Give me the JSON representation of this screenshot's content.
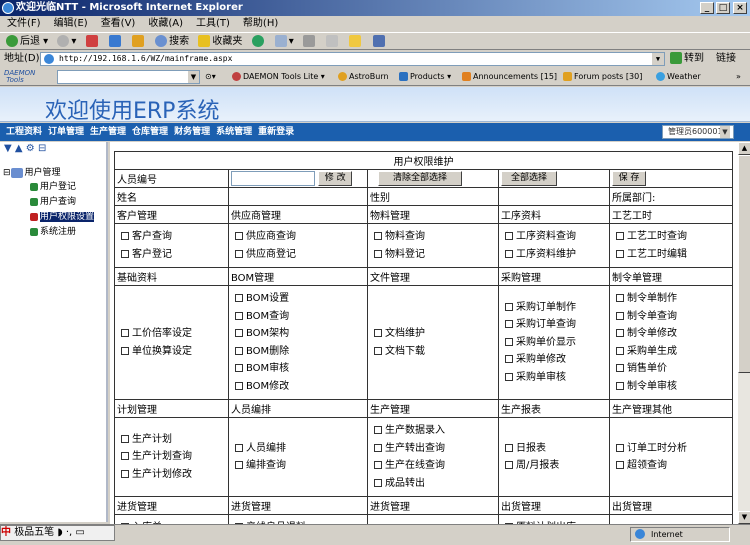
{
  "window": {
    "title": "欢迎光临NTT - Microsoft Internet Explorer"
  },
  "menu": [
    "文件(F)",
    "编辑(E)",
    "查看(V)",
    "收藏(A)",
    "工具(T)",
    "帮助(H)"
  ],
  "toolbar": {
    "back": "后退",
    "search": "搜索",
    "favorites": "收藏夹"
  },
  "address": {
    "label": "地址(D)",
    "url": "http://192.168.1.6/WZ/mainframe.aspx",
    "go": "转到",
    "links": "链接"
  },
  "linksbar": {
    "daemon": "DAEMON Tools",
    "daemon_lite": "DAEMON Tools Lite",
    "astroburn": "AstroBurn",
    "products": "Products",
    "announcements": "Announcements [15]",
    "forum": "Forum posts [30]",
    "weather": "Weather"
  },
  "banner": {
    "title": "欢迎使用ERP系统"
  },
  "modules": [
    "工程资料",
    "订单管理",
    "生产管理",
    "仓库管理",
    "财务管理",
    "系统管理",
    "重新登录"
  ],
  "admin_select": "管理员600001",
  "sidebar": {
    "root": "用户管理",
    "items": [
      "用户登记",
      "用户查询",
      "用户权限设置",
      "系统注册"
    ]
  },
  "form": {
    "title": "用户权限维护",
    "user_no": "人员编号",
    "modify": "修 改",
    "clear_all": "清除全部选择",
    "select_all": "全部选择",
    "save": "保 存",
    "name": "姓名",
    "gender": "性别",
    "dept": "所属部门:",
    "groups": [
      {
        "headers": [
          "客户管理",
          "供应商管理",
          "物料管理",
          "工序资料",
          "工艺工时"
        ],
        "cells": [
          [
            "客户查询",
            "客户登记"
          ],
          [
            "供应商查询",
            "供应商登记"
          ],
          [
            "物料查询",
            "物料登记"
          ],
          [
            "工序资料查询",
            "工序资料维护"
          ],
          [
            "工艺工时查询",
            "工艺工时编辑"
          ]
        ]
      },
      {
        "headers": [
          "基础资料",
          "BOM管理",
          "文件管理",
          "采购管理",
          "制令单管理"
        ],
        "cells": [
          [
            "工价倍率设定",
            "单位换算设定"
          ],
          [
            "BOM设置",
            "BOM查询",
            "BOM架构",
            "BOM删除",
            "BOM审核",
            "BOM修改"
          ],
          [
            "文档维护",
            "文档下载"
          ],
          [
            "采购订单制作",
            "采购订单查询",
            "采购单价显示",
            "采购单修改",
            "采购单审核"
          ],
          [
            "制令单制作",
            "制令单查询",
            "制令单修改",
            "采购单生成",
            "销售单价",
            "制令单审核"
          ]
        ]
      },
      {
        "headers": [
          "计划管理",
          "人员编排",
          "生产管理",
          "生产报表",
          "生产管理其他"
        ],
        "cells": [
          [
            "生产计划",
            "生产计划查询",
            "生产计划修改"
          ],
          [
            "人员编排",
            "编排查询"
          ],
          [
            "生产数据录入",
            "生产转出查询",
            "生产在线查询",
            "成品转出"
          ],
          [
            "日报表",
            "周/月报表"
          ],
          [
            "订单工时分析",
            "超领查询"
          ]
        ]
      },
      {
        "headers": [
          "进货管理",
          "进货管理",
          "进货管理",
          "出货管理",
          "出货管理"
        ],
        "cells": [
          [
            "入库单"
          ],
          [
            "产线良品退料"
          ],
          [],
          [
            "原料计划出库"
          ],
          []
        ]
      }
    ]
  },
  "status": {
    "zone": "Internet",
    "ime": "极品五笔"
  }
}
